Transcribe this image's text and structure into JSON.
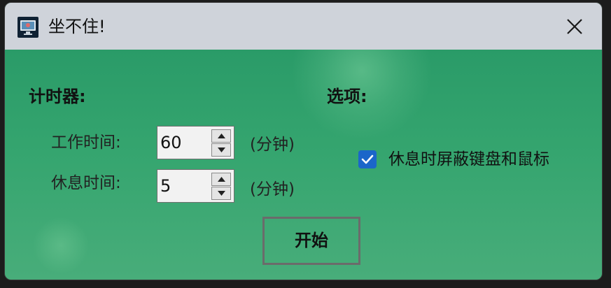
{
  "window": {
    "title": "坐不住!",
    "icon": "app-monitor-icon",
    "close_icon": "close-icon"
  },
  "timer": {
    "heading": "计时器:",
    "work": {
      "label": "工作时间:",
      "value": "60",
      "unit": "(分钟)"
    },
    "rest": {
      "label": "休息时间:",
      "value": "5",
      "unit": "(分钟)"
    }
  },
  "options": {
    "heading": "选项:",
    "block_input": {
      "label": "休息时屏蔽键盘和鼠标",
      "checked": true
    }
  },
  "actions": {
    "start_label": "开始"
  },
  "colors": {
    "titlebar": "#cfd3da",
    "background": "#2f9d6a",
    "checkbox": "#1b66c9"
  }
}
